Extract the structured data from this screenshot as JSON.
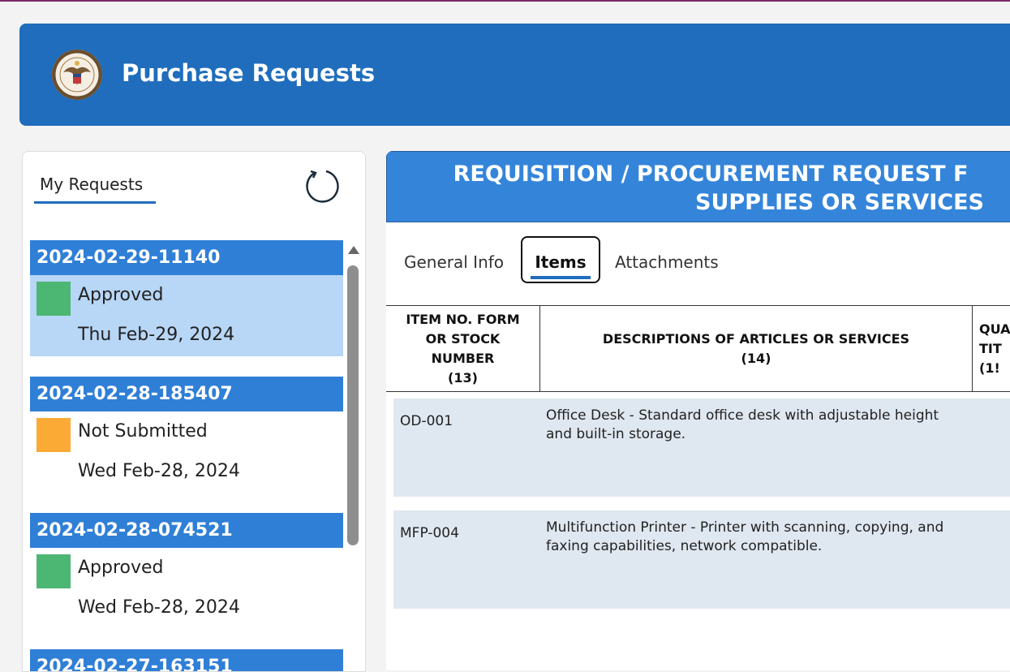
{
  "app": {
    "title": "Purchase Requests",
    "brand_color": "#1f6dbc"
  },
  "sidebar": {
    "tab_label": "My Requests",
    "refresh_icon": "refresh-icon",
    "requests": [
      {
        "id": "2024-02-29-11140",
        "status": "Approved",
        "status_color": "#4cb673",
        "date": "Thu Feb-29, 2024",
        "selected": true
      },
      {
        "id": "2024-02-28-185407",
        "status": "Not Submitted",
        "status_color": "#fbaa35",
        "date": "Wed Feb-28, 2024",
        "selected": false
      },
      {
        "id": "2024-02-28-074521",
        "status": "Approved",
        "status_color": "#4cb673",
        "date": "Wed Feb-28, 2024",
        "selected": false
      },
      {
        "id": "2024-02-27-163151",
        "status": "",
        "status_color": "",
        "date": "",
        "selected": false
      }
    ]
  },
  "form": {
    "title_line1": "REQUISITION / PROCUREMENT REQUEST F",
    "title_line2": "SUPPLIES OR SERVICES",
    "tabs": [
      {
        "label": "General Info"
      },
      {
        "label": "Items",
        "active": true
      },
      {
        "label": "Attachments"
      }
    ],
    "table": {
      "headers": [
        {
          "line1": "ITEM NO. FORM",
          "line2": "OR STOCK",
          "line3": "NUMBER",
          "line4": "(13)"
        },
        {
          "line1": "DESCRIPTIONS OF ARTICLES OR SERVICES",
          "line2": "(14)"
        },
        {
          "line1": "QUA",
          "line2": "TIT",
          "line3": "(1!"
        }
      ],
      "rows": [
        {
          "id": "OD-001",
          "description": "Office Desk - Standard office desk with adjustable height and built-in storage."
        },
        {
          "id": "MFP-004",
          "description": "Multifunction Printer - Printer with scanning, copying, and faxing capabilities, network compatible."
        }
      ]
    }
  }
}
